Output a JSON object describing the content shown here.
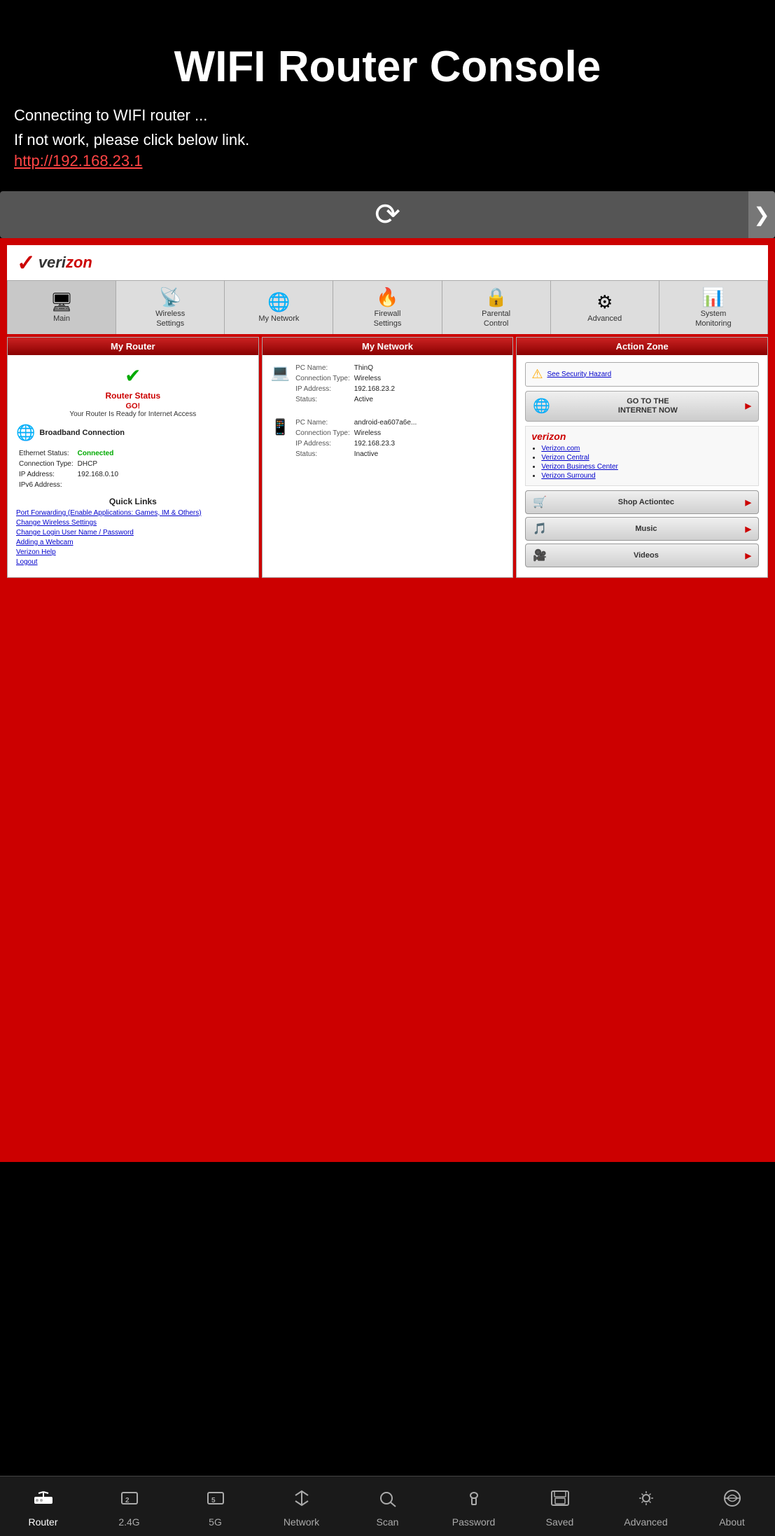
{
  "header": {
    "title": "WIFI Router Console",
    "subtitle_line1": "Connecting to WIFI router ...",
    "subtitle_line2": "If not work, please click below link.",
    "link_text": "http://192.168.23.1"
  },
  "browser": {
    "arrow_label": "❯"
  },
  "verizon": {
    "logo_text": "veri",
    "logo_slash": "zon"
  },
  "nav_tabs": [
    {
      "label": "Main",
      "icon": "🖥"
    },
    {
      "label": "Wireless\nSettings",
      "icon": "📡"
    },
    {
      "label": "My Network",
      "icon": "🌐"
    },
    {
      "label": "Firewall\nSettings",
      "icon": "🔥"
    },
    {
      "label": "Parental\nControl",
      "icon": "🔒"
    },
    {
      "label": "Advanced",
      "icon": "⚙"
    },
    {
      "label": "System\nMonitoring",
      "icon": "📊"
    }
  ],
  "my_router": {
    "panel_title": "My Router",
    "status_title": "Router Status",
    "status_go": "GO!",
    "status_desc": "Your Router Is Ready for Internet Access",
    "broadband_label": "Broadband Connection",
    "ethernet_status_label": "Ethernet Status:",
    "ethernet_status_value": "Connected",
    "connection_type_label": "Connection Type:",
    "connection_type_value": "DHCP",
    "ip_label": "IP Address:",
    "ip_value": "192.168.0.10",
    "ipv6_label": "IPv6 Address:",
    "ipv6_value": "",
    "quick_links_title": "Quick Links",
    "links": [
      "Port Forwarding (Enable Applications: Games, IM & Others)",
      "Change Wireless Settings",
      "Change Login User Name / Password",
      "Adding a Webcam",
      "Verizon Help",
      "Logout"
    ]
  },
  "my_network": {
    "panel_title": "My Network",
    "devices": [
      {
        "name_label": "PC Name:",
        "name_value": "ThinQ",
        "conn_label": "Connection Type:",
        "conn_value": "Wireless",
        "ip_label": "IP Address:",
        "ip_value": "192.168.23.2",
        "status_label": "Status:",
        "status_value": "Active"
      },
      {
        "name_label": "PC Name:",
        "name_value": "android-ea607a6e...",
        "conn_label": "Connection Type:",
        "conn_value": "Wireless",
        "ip_label": "IP Address:",
        "ip_value": "192.168.23.3",
        "status_label": "Status:",
        "status_value": "Inactive"
      }
    ]
  },
  "action_zone": {
    "panel_title": "Action Zone",
    "security_link": "See Security Hazard",
    "go_internet_label": "GO TO THE INTERNET NOW",
    "verizon_links": [
      "Verizon.com",
      "Verizon Central",
      "Verizon Business Center",
      "Verizon Surround"
    ],
    "buttons": [
      {
        "label": "Shop Actiontec",
        "icon": "🛒"
      },
      {
        "label": "Music",
        "icon": "🎵"
      },
      {
        "label": "Videos",
        "icon": "🎥"
      }
    ]
  },
  "bottom_nav": {
    "items": [
      {
        "label": "Router",
        "icon": "router",
        "active": true
      },
      {
        "label": "2.4G",
        "icon": "2g"
      },
      {
        "label": "5G",
        "icon": "5g"
      },
      {
        "label": "Network",
        "icon": "network"
      },
      {
        "label": "Scan",
        "icon": "scan"
      },
      {
        "label": "Password",
        "icon": "password"
      },
      {
        "label": "Saved",
        "icon": "saved"
      },
      {
        "label": "Advanced",
        "icon": "advanced"
      },
      {
        "label": "About",
        "icon": "about"
      }
    ]
  }
}
